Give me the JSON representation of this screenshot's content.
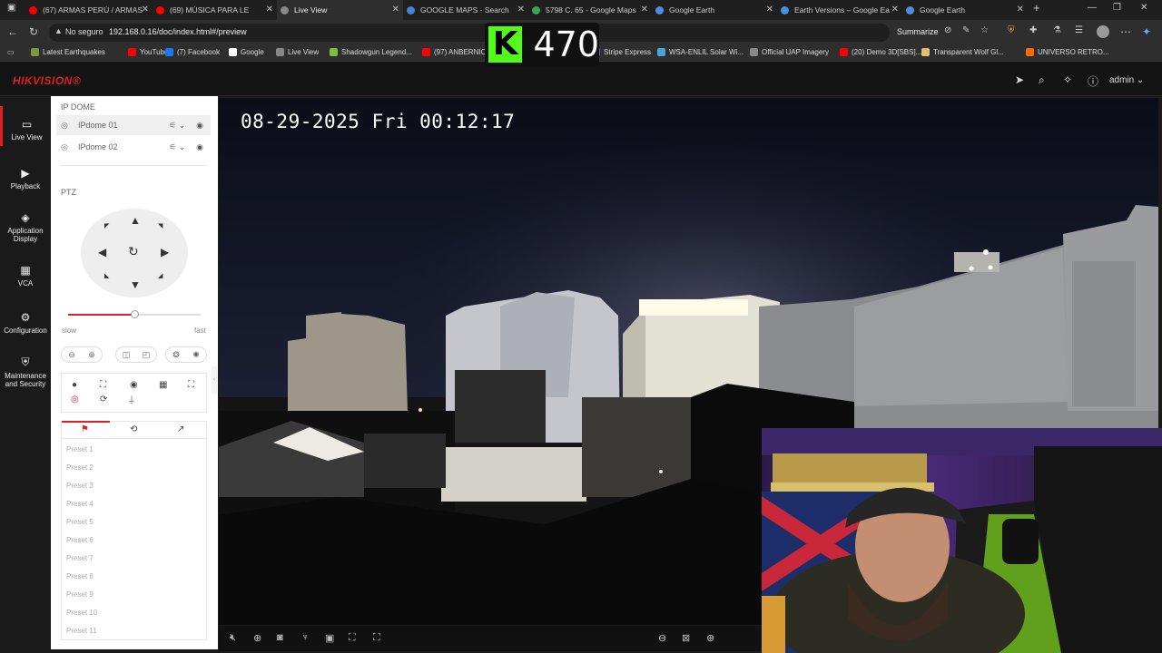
{
  "browser": {
    "tabs": [
      {
        "title": "(67) ARMAS PERÚ / ARMAS",
        "favicon_color": "#ff0000"
      },
      {
        "title": "(69) MÚSICA PARA LE",
        "favicon_color": "#ff0000"
      },
      {
        "title": "Live View",
        "favicon_color": "#888888"
      },
      {
        "title": "GOOGLE MAPS - Search",
        "favicon_color": "#4a7fd6"
      },
      {
        "title": "5798 C. 65 - Google Maps",
        "favicon_color": "#34a853"
      },
      {
        "title": "Google Earth",
        "favicon_color": "#4a90e2"
      },
      {
        "title": "Earth Versions – Google Ea",
        "favicon_color": "#4a90e2"
      },
      {
        "title": "Google Earth",
        "favicon_color": "#4a90e2"
      }
    ],
    "address": {
      "security": "No seguro",
      "url": "192.168.0.16/doc/index.html#/preview",
      "summarize": "Summarize"
    },
    "bookmarks": [
      {
        "label": "Latest Earthquakes",
        "color": "#7a9a3a"
      },
      {
        "label": "YouTube",
        "color": "#ff0000"
      },
      {
        "label": "(7) Facebook",
        "color": "#1877f2"
      },
      {
        "label": "Google",
        "color": "#ffffff"
      },
      {
        "label": "Live View",
        "color": "#888888"
      },
      {
        "label": "Shadowgun Legend...",
        "color": "#7bbf3a"
      },
      {
        "label": "(97) ANBERNIC",
        "color": "#ff0000"
      },
      {
        "label": "Stripe Express",
        "color": "#635bff"
      },
      {
        "label": "WSA-ENLIL Solar Wi...",
        "color": "#4aa3df"
      },
      {
        "label": "Official UAP Imagery",
        "color": "#888888"
      },
      {
        "label": "(20) Demo 3D[SBS]...",
        "color": "#ff0000"
      },
      {
        "label": "Transparent Wolf Gl...",
        "color": "#e0c070"
      },
      {
        "label": "UNIVERSO RETRO...",
        "color": "#ff6a00"
      }
    ]
  },
  "overlay": {
    "kick_letter": "K",
    "kick_count": "470",
    "kick_color": "#53fc18"
  },
  "hik": {
    "logo": "HIKVISION®",
    "user": "admin",
    "nav": [
      {
        "label": "Live View",
        "icon": "monitor-icon"
      },
      {
        "label": "Playback",
        "icon": "playback-icon"
      },
      {
        "label": "Application Display",
        "icon": "app-icon"
      },
      {
        "label": "VCA",
        "icon": "grid-icon"
      },
      {
        "label": "Configuration",
        "icon": "gear-icon"
      },
      {
        "label": "Maintenance and Security",
        "icon": "shield-icon"
      }
    ],
    "section_title": "IP DOME",
    "devices": [
      "IPdome 01",
      "IPdome 02"
    ],
    "ptz_label": "PTZ",
    "speed_slow": "slow",
    "speed_fast": "fast",
    "speed_value": 0.5,
    "presets": [
      "Preset 1",
      "Preset 2",
      "Preset 3",
      "Preset 4",
      "Preset 5",
      "Preset 6",
      "Preset 7",
      "Preset 8",
      "Preset 9",
      "Preset 10",
      "Preset 11"
    ],
    "osd_timestamp": "08-29-2025 Fri 00:12:17"
  },
  "colors": {
    "brand_red": "#e02020",
    "accent_green": "#53fc18"
  }
}
